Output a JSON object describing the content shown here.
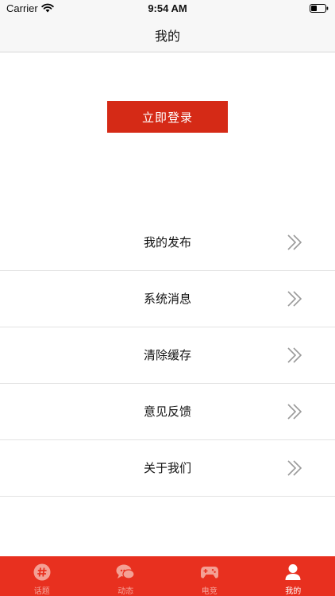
{
  "status_bar": {
    "carrier": "Carrier",
    "time": "9:54 AM"
  },
  "nav": {
    "title": "我的"
  },
  "login": {
    "label": "立即登录",
    "color": "#d52a16"
  },
  "menu": {
    "items": [
      {
        "label": "我的发布"
      },
      {
        "label": "系统消息"
      },
      {
        "label": "清除缓存"
      },
      {
        "label": "意见反馈"
      },
      {
        "label": "关于我们"
      }
    ]
  },
  "tab_bar": {
    "color": "#e8301f",
    "tabs": [
      {
        "label": "话题",
        "icon": "hashtag-icon",
        "active": false
      },
      {
        "label": "动态",
        "icon": "chat-bubbles-icon",
        "active": false
      },
      {
        "label": "电竞",
        "icon": "gamepad-icon",
        "active": false
      },
      {
        "label": "我的",
        "icon": "user-icon",
        "active": true
      }
    ]
  }
}
